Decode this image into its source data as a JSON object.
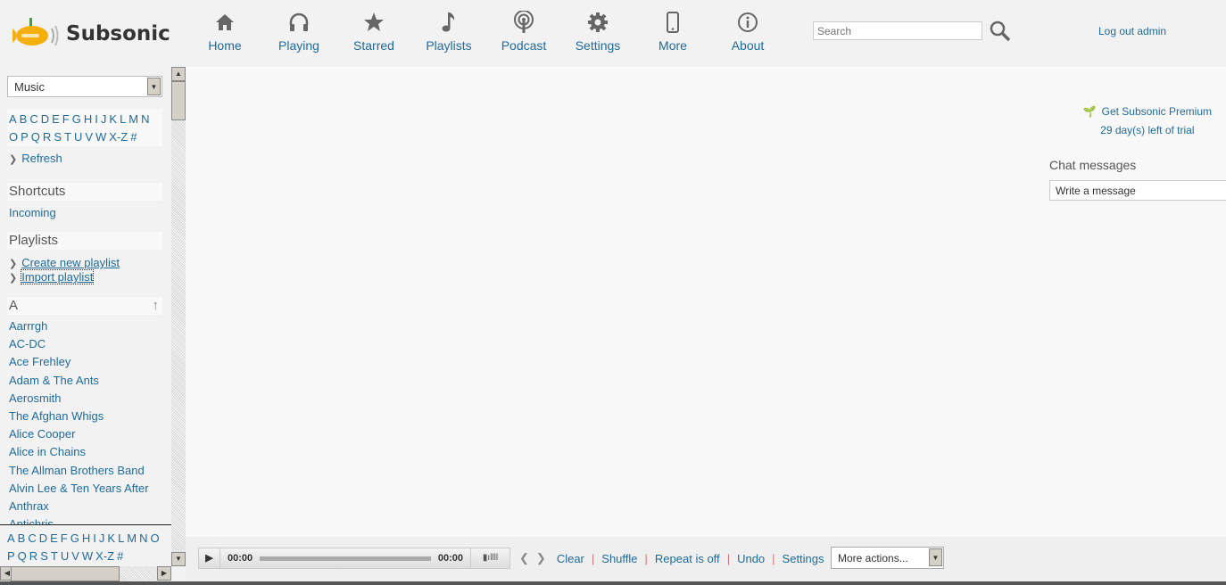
{
  "app": {
    "name": "Subsonic"
  },
  "nav": [
    {
      "label": "Home",
      "icon": "home-icon"
    },
    {
      "label": "Playing",
      "icon": "headphones-icon"
    },
    {
      "label": "Starred",
      "icon": "star-icon"
    },
    {
      "label": "Playlists",
      "icon": "music-note-icon"
    },
    {
      "label": "Podcast",
      "icon": "podcast-icon"
    },
    {
      "label": "Settings",
      "icon": "gear-icon"
    },
    {
      "label": "More",
      "icon": "phone-icon"
    },
    {
      "label": "About",
      "icon": "info-icon"
    }
  ],
  "search": {
    "placeholder": "Search"
  },
  "logout": "Log out admin",
  "sidebar": {
    "folder": "Music",
    "alpha_row1": [
      "A",
      "B",
      "C",
      "D",
      "E",
      "F",
      "G",
      "H",
      "I",
      "J",
      "K",
      "L",
      "M",
      "N"
    ],
    "alpha_row2": [
      "O",
      "P",
      "Q",
      "R",
      "S",
      "T",
      "U",
      "V",
      "W",
      "X-Z",
      "#"
    ],
    "refresh": "Refresh",
    "shortcuts_title": "Shortcuts",
    "shortcuts": [
      "Incoming"
    ],
    "playlists_title": "Playlists",
    "create_playlist": "Create new playlist",
    "import_playlist": "Import playlist",
    "index_letter": "A",
    "artists": [
      "Aarrrgh",
      "AC-DC",
      "Ace Frehley",
      "Adam & The Ants",
      "Aerosmith",
      "The Afghan Whigs",
      "Alice Cooper",
      "Alice in Chains",
      "The Allman Brothers Band",
      "Alvin Lee & Ten Years After",
      "Anthrax",
      "Antichris"
    ],
    "bottom_alpha_row1": [
      "A",
      "B",
      "C",
      "D",
      "E",
      "F",
      "G",
      "H",
      "I",
      "J",
      "K",
      "L",
      "M",
      "N",
      "O"
    ],
    "bottom_alpha_row2": [
      "P",
      "Q",
      "R",
      "S",
      "T",
      "U",
      "V",
      "W",
      "X-Z",
      "#"
    ]
  },
  "premium": {
    "title": "Get Subsonic Premium",
    "trial": "29 day(s) left of trial"
  },
  "chat": {
    "title": "Chat messages",
    "placeholder": "Write a message"
  },
  "player": {
    "time_current": "00:00",
    "time_total": "00:00",
    "progress": 0
  },
  "controls": {
    "clear": "Clear",
    "shuffle": "Shuffle",
    "repeat": "Repeat is off",
    "undo": "Undo",
    "settings": "Settings",
    "more_actions": "More actions..."
  }
}
